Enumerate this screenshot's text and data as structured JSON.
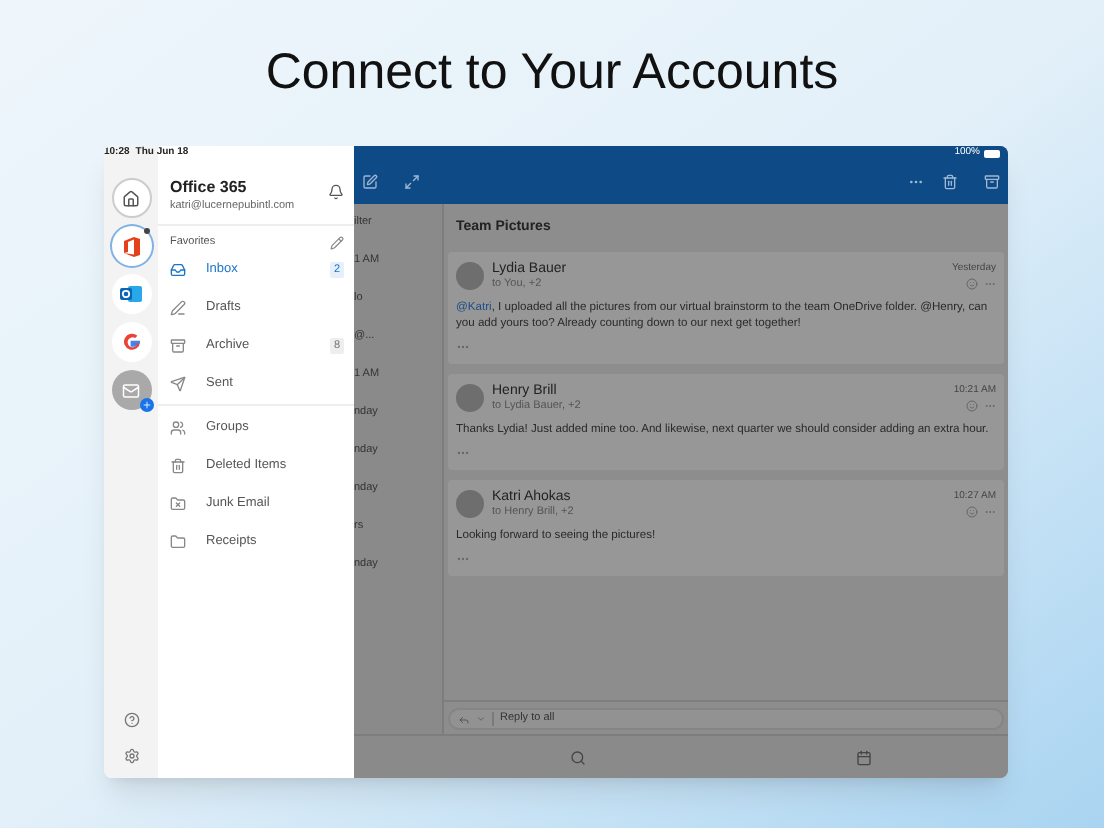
{
  "headline": "Connect to Your Accounts",
  "status_bar": {
    "time": "10:28",
    "date": "Thu Jun 18",
    "battery": "100%"
  },
  "account_rail": [
    {
      "kind": "home",
      "selected": false
    },
    {
      "kind": "office",
      "selected": true
    },
    {
      "kind": "outlook",
      "selected": false
    },
    {
      "kind": "google",
      "selected": false
    },
    {
      "kind": "mail",
      "selected": false
    }
  ],
  "drawer": {
    "title": "Office 365",
    "email": "katri@lucernepubintl.com",
    "section": "Favorites",
    "favorites": [
      {
        "kind": "inbox",
        "label": "Inbox",
        "selected": true,
        "count": "2"
      },
      {
        "kind": "drafts",
        "label": "Drafts",
        "selected": false
      },
      {
        "kind": "archive",
        "label": "Archive",
        "selected": false,
        "count": "8"
      },
      {
        "kind": "sent",
        "label": "Sent",
        "selected": false
      }
    ],
    "folders": [
      {
        "kind": "groups",
        "label": "Groups",
        "selected": false
      },
      {
        "kind": "trash",
        "label": "Deleted Items",
        "selected": false
      },
      {
        "kind": "junk",
        "label": "Junk Email",
        "selected": false
      },
      {
        "kind": "folder",
        "label": "Receipts",
        "selected": false
      }
    ]
  },
  "message_list_fragments": [
    "ilter",
    "1 AM",
    "lo",
    "@...",
    "1 AM",
    "nday",
    "nday",
    "nday",
    "rs",
    "nday"
  ],
  "thread": {
    "subject": "Team Pictures",
    "messages": [
      {
        "sender": "Lydia Bauer",
        "recipients": "to You, +2",
        "time": "Yesterday",
        "mention": "@Katri",
        "body": ", I uploaded all the pictures from our virtual brainstorm to the team OneDrive folder. @Henry, can you add yours too? Already counting down to our next get together!"
      },
      {
        "sender": "Henry Brill",
        "recipients": "to Lydia Bauer, +2",
        "time": "10:21 AM",
        "body": "Thanks Lydia! Just added mine too. And likewise, next quarter we should consider adding an extra hour."
      },
      {
        "sender": "Katri Ahokas",
        "recipients": "to Henry Brill, +2",
        "time": "10:27 AM",
        "body": "Looking forward to seeing the pictures!"
      }
    ],
    "reply_placeholder": "Reply to all"
  }
}
